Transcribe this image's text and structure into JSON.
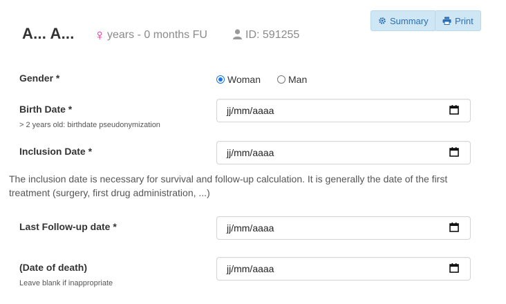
{
  "header": {
    "patient_name": "A... A...",
    "gender_symbol": "♀",
    "followup_text": "years - 0 months FU",
    "patient_id": "ID: 591255"
  },
  "toolbar": {
    "summary_label": "Summary",
    "print_label": "Print"
  },
  "form": {
    "gender": {
      "label": "Gender *",
      "options": [
        "Woman",
        "Man"
      ],
      "selected": "Woman"
    },
    "birth_date": {
      "label": "Birth Date *",
      "hint": "> 2 years old: birthdate pseudonymization",
      "placeholder": "jj/mm/aaaa"
    },
    "inclusion_date": {
      "label": "Inclusion Date *",
      "placeholder": "jj/mm/aaaa",
      "help_text": "The inclusion date is necessary for survival and follow-up calculation. It is generally the date of the first treatment (surgery, first drug administration, ...)"
    },
    "last_followup_date": {
      "label": "Last Follow-up date *",
      "placeholder": "jj/mm/aaaa"
    },
    "date_of_death": {
      "label": "(Date of death)",
      "hint": "Leave blank if inappropriate",
      "placeholder": "jj/mm/aaaa"
    }
  },
  "colors": {
    "button_bg": "#cfe6f5",
    "button_text": "#2a6fb5",
    "female_symbol": "#e0228c",
    "muted_text": "#8a8a8a"
  },
  "icons": [
    "gear-icon",
    "printer-icon",
    "female-icon",
    "user-icon",
    "calendar-icon"
  ]
}
